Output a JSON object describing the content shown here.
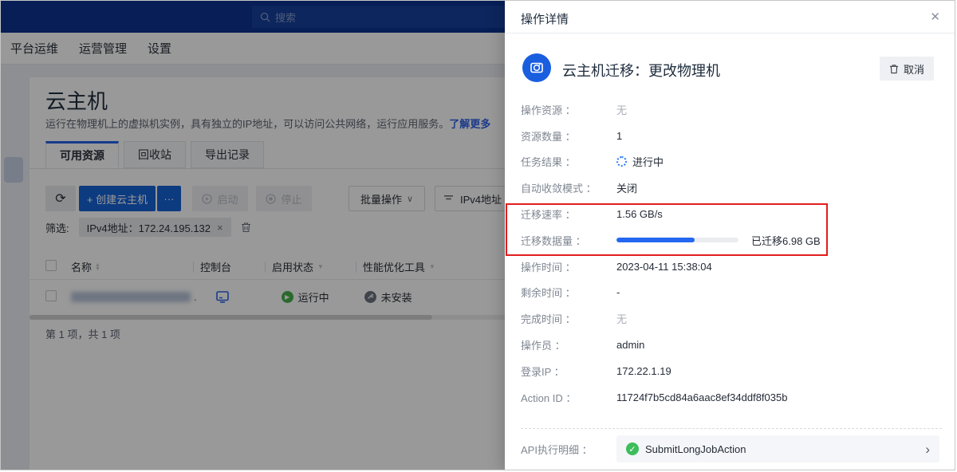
{
  "topbar": {
    "search_placeholder": "搜索"
  },
  "nav": {
    "items": [
      {
        "label": "平台运维"
      },
      {
        "label": "运营管理"
      },
      {
        "label": "设置"
      }
    ]
  },
  "page": {
    "title": "云主机",
    "description": "运行在物理机上的虚拟机实例，具有独立的IP地址，可以访问公共网络，运行应用服务。",
    "learn_more": "了解更多",
    "tabs": [
      {
        "label": "可用资源"
      },
      {
        "label": "回收站"
      },
      {
        "label": "导出记录"
      }
    ],
    "toolbar": {
      "refresh_icon": "⟳",
      "create": "+ 创建云主机",
      "more": "···",
      "start": "启动",
      "stop": "停止",
      "batch": "批量操作",
      "batch_caret": "∨",
      "filter_field": "IPv4地址"
    },
    "filter": {
      "label": "筛选:",
      "tag": "IPv4地址：172.24.195.132",
      "tag_close": "×"
    },
    "table": {
      "headers": {
        "name": "名称",
        "console": "控制台",
        "status": "启用状态",
        "perf": "性能优化工具"
      },
      "row": {
        "name_suffix": ".",
        "status": "运行中",
        "perf": "未安装"
      }
    },
    "footer": "第 1 项，共 1 项"
  },
  "drawer": {
    "title": "操作详情",
    "close": "✕",
    "action_title": "云主机迁移：更改物理机",
    "cancel": "取消",
    "rows": [
      {
        "label": "操作资源 ：",
        "value": "无"
      },
      {
        "label": "资源数量 ：",
        "value": "1"
      },
      {
        "label": "任务结果 ：",
        "value": "进行中"
      },
      {
        "label": "自动收敛模式 ：",
        "value": "关闭"
      },
      {
        "label": "迁移速率 ：",
        "value": "1.56 GB/s"
      },
      {
        "label": "迁移数据量 ：",
        "value": "已迁移6.98 GB"
      },
      {
        "label": "操作时间 ：",
        "value": "2023-04-11 15:38:04"
      },
      {
        "label": "剩余时间 ：",
        "value": "-"
      },
      {
        "label": "完成时间 ：",
        "value": "无"
      },
      {
        "label": "操作员 ：",
        "value": "admin"
      },
      {
        "label": "登录IP ：",
        "value": "172.22.1.19"
      },
      {
        "label": "Action ID ：",
        "value": "11724f7b5cd84a6aac8ef34ddf8f035b"
      }
    ],
    "progress_percent": 64,
    "api": {
      "label": "API执行明细 ：",
      "value": "SubmitLongJobAction",
      "chevron": "›",
      "check": "✓"
    }
  },
  "colors": {
    "accent_blue": "#1763d6",
    "progress_blue": "#2468f2",
    "annotation_red": "#e11d1d",
    "success_green": "#3dbd5c",
    "running_green": "#49b04c",
    "link_blue": "#2e62e8"
  }
}
